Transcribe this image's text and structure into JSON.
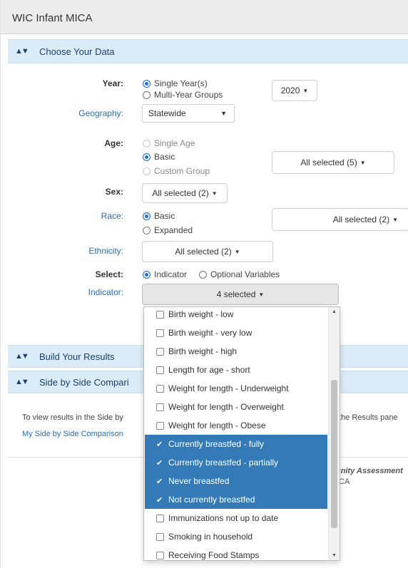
{
  "app": {
    "title": "WIC Infant MICA"
  },
  "sections": {
    "choose": "Choose Your Data",
    "build": "Build Your Results",
    "side": "Side by Side Compari"
  },
  "labels": {
    "year": "Year:",
    "geography": "Geography:",
    "age": "Age:",
    "sex": "Sex:",
    "race": "Race:",
    "ethnicity": "Ethnicity:",
    "select": "Select:",
    "indicator": "Indicator:"
  },
  "year": {
    "single": "Single Year(s)",
    "multi": "Multi-Year Groups",
    "value": "2020"
  },
  "geography": {
    "value": "Statewide"
  },
  "age": {
    "single": "Single Age",
    "basic": "Basic",
    "custom": "Custom Group",
    "selected": "All selected (5)"
  },
  "sex": {
    "selected": "All selected (2)"
  },
  "race": {
    "basic": "Basic",
    "expanded": "Expanded",
    "selected": "All selected (2)"
  },
  "ethnicity": {
    "selected": "All selected (2)"
  },
  "select_opts": {
    "indicator": "Indicator",
    "optional": "Optional Variables"
  },
  "indicator": {
    "selected": "4 selected",
    "items": [
      {
        "label": "Birth weight - low",
        "checked": false
      },
      {
        "label": "Birth weight - very low",
        "checked": false
      },
      {
        "label": "Birth weight - high",
        "checked": false
      },
      {
        "label": "Length for age - short",
        "checked": false
      },
      {
        "label": "Weight for length - Underweight",
        "checked": false
      },
      {
        "label": "Weight for length - Overweight",
        "checked": false
      },
      {
        "label": "Weight for length - Obese",
        "checked": false
      },
      {
        "label": "Currently breastfed - fully",
        "checked": true
      },
      {
        "label": "Currently breastfed - partially",
        "checked": true
      },
      {
        "label": "Never breastfed",
        "checked": true
      },
      {
        "label": "Not currently breastfed",
        "checked": true
      },
      {
        "label": "Immunizations not up to date",
        "checked": false
      },
      {
        "label": "Smoking in household",
        "checked": false
      },
      {
        "label": "Receiving Food Stamps",
        "checked": false
      }
    ]
  },
  "side_text": {
    "left": "To view results in the Side by",
    "right": "the Results pane",
    "link": "My Side by Side Comparison"
  },
  "footer": {
    "note1": "unity Assessment",
    "note2": "CA"
  },
  "colors": {
    "accent": "#337ab7",
    "section": "#d9ecf8"
  }
}
